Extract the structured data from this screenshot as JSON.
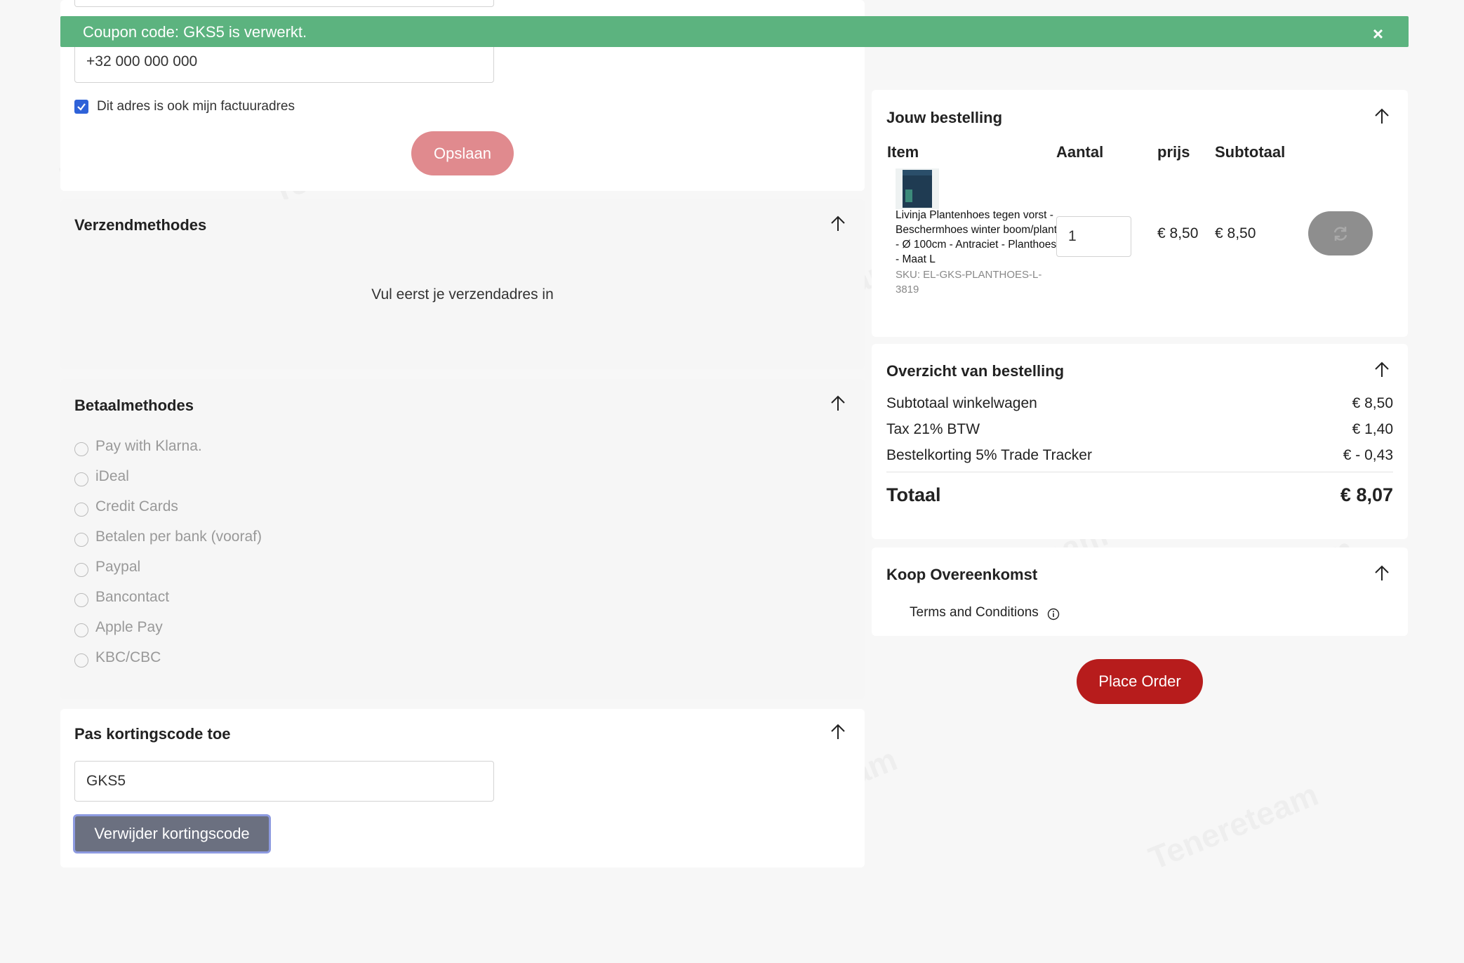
{
  "notice": {
    "text": "Coupon code: GKS5 is verwerkt.",
    "close": "×"
  },
  "address": {
    "phone_value": "+32 000 000 000",
    "billing_checkbox_label": "Dit adres is ook mijn factuuradres",
    "billing_checked": true,
    "save_label": "Opslaan"
  },
  "shipping": {
    "title": "Verzendmethodes",
    "empty_text": "Vul eerst je verzendadres in"
  },
  "payment": {
    "title": "Betaalmethodes",
    "methods": [
      "Pay with Klarna.",
      "iDeal",
      "Credit Cards",
      "Betalen per bank (vooraf)",
      "Paypal",
      "Bancontact",
      "Apple Pay",
      "KBC/CBC"
    ]
  },
  "coupon": {
    "title": "Pas kortingscode toe",
    "value": "GKS5",
    "remove_label": "Verwijder kortingscode"
  },
  "order": {
    "title": "Jouw bestelling",
    "headers": {
      "item": "Item",
      "qty": "Aantal",
      "price": "prijs",
      "subtotal": "Subtotaal"
    },
    "item": {
      "name": "Livinja Plantenhoes tegen vorst - Beschermhoes winter boom/plant - Ø 100cm - Antraciet - Planthoes - Maat L",
      "sku": "SKU: EL-GKS-PLANTHOES-L-3819",
      "qty": "1",
      "price": "€ 8,50",
      "subtotal": "€ 8,50"
    }
  },
  "summary": {
    "title": "Overzicht van bestelling",
    "rows": [
      {
        "label": "Subtotaal winkelwagen",
        "value": "€ 8,50"
      },
      {
        "label": "Tax 21% BTW",
        "value": "€ 1,40"
      },
      {
        "label": "Bestelkorting 5% Trade Tracker",
        "value": "€ - 0,43"
      }
    ],
    "total_label": "Totaal",
    "total_value": "€ 8,07"
  },
  "agreement": {
    "title": "Koop Overeenkomst",
    "terms_label": "Terms and Conditions"
  },
  "place_order_label": "Place Order",
  "colors": {
    "notice": "#5cb37f",
    "save": "#e08a8e",
    "place_order": "#b71c1c",
    "remove_coupon": "#6b7080",
    "checkbox": "#2f62d8"
  }
}
